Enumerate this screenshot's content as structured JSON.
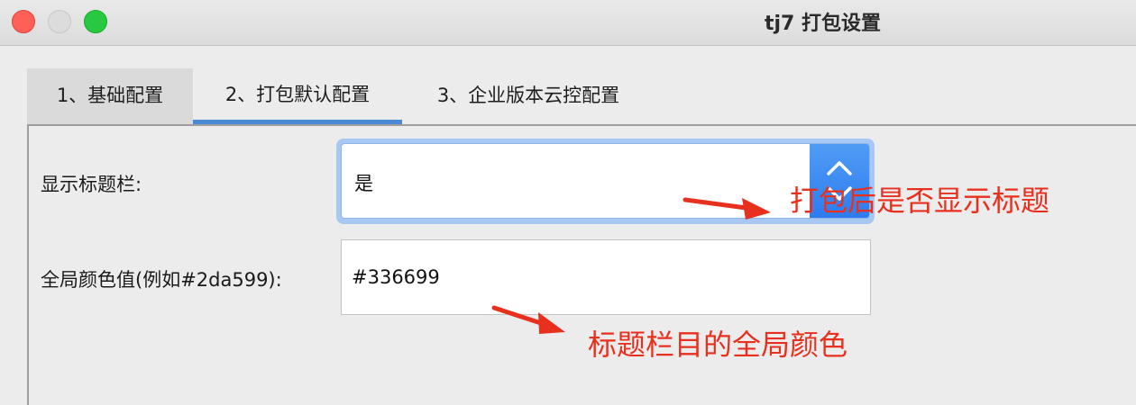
{
  "window": {
    "title": "tj7 打包设置"
  },
  "tabs": [
    {
      "label": "1、基础配置",
      "selected": false
    },
    {
      "label": "2、打包默认配置",
      "selected": true
    },
    {
      "label": "3、企业版本云控配置",
      "selected": false
    }
  ],
  "form": {
    "show_title_bar": {
      "label": "显示标题栏:",
      "value": "是"
    },
    "global_color": {
      "label": "全局颜色值(例如#2da599):",
      "value": "#336699"
    }
  },
  "annotations": [
    {
      "text": "打包后是否显示标题"
    },
    {
      "text": "标题栏目的全局颜色"
    }
  ],
  "colors": {
    "accent": "#4a8ad4",
    "annotation": "#e8301e",
    "close": "#fe5f57",
    "maximize": "#28c840"
  },
  "icons": {
    "select_arrows": "chevron-up-down-icon"
  }
}
